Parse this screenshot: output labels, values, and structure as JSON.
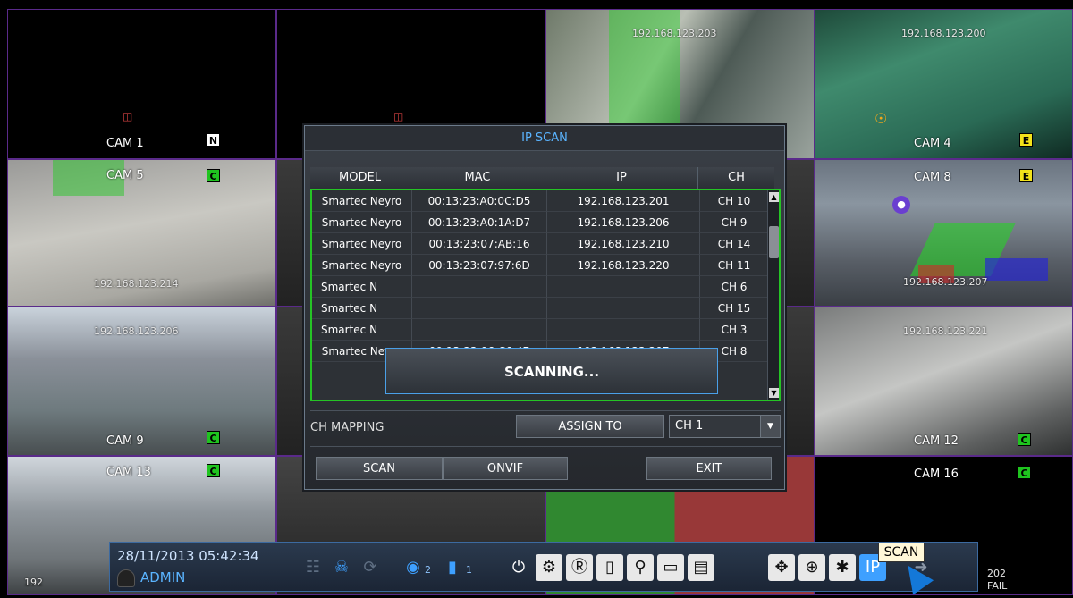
{
  "cameras": [
    {
      "name": "CAM 1",
      "badge": "N",
      "ip": ""
    },
    {
      "name": "",
      "badge": "",
      "ip": ""
    },
    {
      "name": "",
      "badge": "",
      "ip": "192.168.123.203"
    },
    {
      "name": "CAM 4",
      "badge": "E",
      "ip": "192.168.123.200"
    },
    {
      "name": "CAM 5",
      "badge": "C",
      "ip": "192.168.123.214"
    },
    {
      "name": "",
      "badge": "",
      "ip": ""
    },
    {
      "name": "",
      "badge": "",
      "ip": ""
    },
    {
      "name": "CAM 8",
      "badge": "E",
      "ip": "192.168.123.207"
    },
    {
      "name": "CAM 9",
      "badge": "C",
      "ip": "192.168.123.206"
    },
    {
      "name": "",
      "badge": "",
      "ip": ""
    },
    {
      "name": "",
      "badge": "",
      "ip": ""
    },
    {
      "name": "CAM 12",
      "badge": "C",
      "ip": "192.168.123.221"
    },
    {
      "name": "CAM 13",
      "badge": "C",
      "ip": "192"
    },
    {
      "name": "",
      "badge": "",
      "ip": ""
    },
    {
      "name": "",
      "badge": "",
      "ip": ""
    },
    {
      "name": "CAM 16",
      "badge": "C",
      "ip": "202"
    }
  ],
  "cam16_status": "FAIL",
  "dialog": {
    "title": "IP SCAN",
    "columns": [
      "MODEL",
      "MAC",
      "IP",
      "CH"
    ],
    "rows": [
      [
        "Smartec Neyro",
        "00:13:23:A0:0C:D5",
        "192.168.123.201",
        "CH 10"
      ],
      [
        "Smartec Neyro",
        "00:13:23:A0:1A:D7",
        "192.168.123.206",
        "CH 9"
      ],
      [
        "Smartec Neyro",
        "00:13:23:07:AB:16",
        "192.168.123.210",
        "CH 14"
      ],
      [
        "Smartec Neyro",
        "00:13:23:07:97:6D",
        "192.168.123.220",
        "CH 11"
      ],
      [
        "Smartec N",
        "",
        "",
        "CH 6"
      ],
      [
        "Smartec N",
        "",
        "",
        "CH 15"
      ],
      [
        "Smartec N",
        "",
        "",
        "CH 3"
      ],
      [
        "Smartec Neyro",
        "00:13:23:06:C6:47",
        "192.168.123.207",
        "CH 8"
      ]
    ],
    "scanning_text": "SCANNING...",
    "ch_mapping_label": "CH MAPPING",
    "assign_label": "ASSIGN TO",
    "assign_value": "CH 1",
    "scan_button": "SCAN",
    "onvif_button": "ONVIF",
    "exit_button": "EXIT"
  },
  "toolbar": {
    "datetime": "28/11/2013 05:42:34",
    "user": "ADMIN",
    "hdd_count": "2",
    "audio_channel": "1",
    "tooltip": "SCAN"
  },
  "colors": {
    "accent": "#5ab4ff",
    "select_border": "#25c425",
    "badge_c": "#1fc41f",
    "badge_e": "#f2e21a"
  }
}
